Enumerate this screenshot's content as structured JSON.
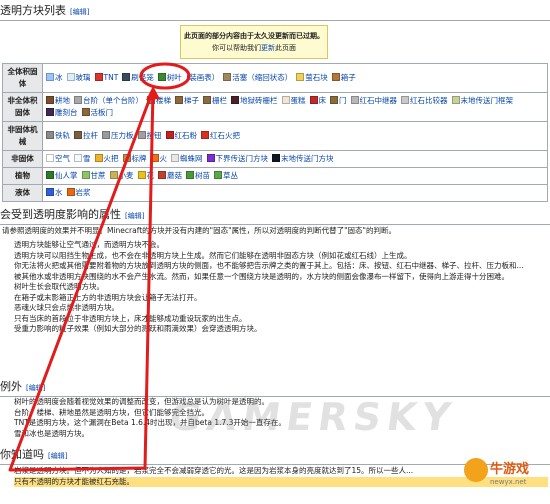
{
  "section1": {
    "title": "透明方块列表",
    "edit": "[编辑]"
  },
  "notice": {
    "line1": "此页面的部分内容由于太久没更新而已过期。",
    "line2_pre": "你可以帮助我们",
    "line2_link": "更新",
    "line2_post": "此页面"
  },
  "table": {
    "rows": [
      {
        "header": "全体积固体",
        "items": [
          {
            "label": "冰",
            "color": "#9bc3ff"
          },
          {
            "label": "玻璃",
            "color": "#d9f0f8"
          },
          {
            "label": "TNT",
            "color": "#d8352b"
          },
          {
            "label": "刷怪笼",
            "color": "#3a4a5a"
          },
          {
            "label": "树叶（装画表）",
            "color": "#3d8a2e"
          },
          {
            "label": "活塞（缩回状态）",
            "color": "#a08860"
          },
          {
            "label": "萤石块",
            "color": "#f1d05a"
          },
          {
            "label": "箱子",
            "color": "#b0783a"
          }
        ]
      },
      {
        "header": "非全体积固体",
        "items": [
          {
            "label": "耕地",
            "color": "#7a4f2a"
          },
          {
            "label": "台阶（单个台阶）",
            "color": "#a9a9a9"
          },
          {
            "label": "楼梯",
            "color": "#9c7b4e"
          },
          {
            "label": "梯子",
            "color": "#8d6a3c"
          },
          {
            "label": "栅栏",
            "color": "#8a6c42"
          },
          {
            "label": "地狱砖栅栏",
            "color": "#4a2328"
          },
          {
            "label": "蛋糕",
            "color": "#f3e5d3"
          },
          {
            "label": "床",
            "color": "#c02a2a"
          },
          {
            "label": "门",
            "color": "#8b6b3c"
          },
          {
            "label": "红石中继器",
            "color": "#b8b8b8"
          },
          {
            "label": "红石比较器",
            "color": "#c9c9c9"
          },
          {
            "label": "末地传送门框架",
            "color": "#c8d39a"
          },
          {
            "label": "雕刻台",
            "color": "#3f2a4f"
          },
          {
            "label": "活板门",
            "color": "#8b6a38"
          }
        ]
      },
      {
        "header": "非固体机械",
        "items": [
          {
            "label": "铁轨",
            "color": "#8a8a8a"
          },
          {
            "label": "拉杆",
            "color": "#7a6040"
          },
          {
            "label": "压力板",
            "color": "#9a9a9a"
          },
          {
            "label": "按钮",
            "color": "#a0a0a0"
          },
          {
            "label": "红石粉",
            "color": "#c02020"
          },
          {
            "label": "红石火把",
            "color": "#d63020"
          }
        ]
      },
      {
        "header": "非固体",
        "items": [
          {
            "label": "空气",
            "color": "#ffffff"
          },
          {
            "label": "雪",
            "color": "#f4f8ff"
          },
          {
            "label": "火把",
            "color": "#f0b030"
          },
          {
            "label": "标牌",
            "color": "#b89050"
          },
          {
            "label": "火",
            "color": "#f07020"
          },
          {
            "label": "蜘蛛网",
            "color": "#e8e8e8"
          },
          {
            "label": "下界传送门方块",
            "color": "#7a2fcf"
          },
          {
            "label": "末地传送门方块",
            "color": "#101820"
          }
        ]
      },
      {
        "header": "植物",
        "items": [
          {
            "label": "仙人掌",
            "color": "#2f7a2a"
          },
          {
            "label": "甘蔗",
            "color": "#8fc46a"
          },
          {
            "label": "小麦",
            "color": "#c9b05a"
          },
          {
            "label": "花",
            "color": "#e8c020"
          },
          {
            "label": "蘑菇",
            "color": "#c04030"
          },
          {
            "label": "树苗",
            "color": "#4a9a3a"
          },
          {
            "label": "草丛",
            "color": "#5aa84a"
          }
        ]
      },
      {
        "header": "液体",
        "items": [
          {
            "label": "水",
            "color": "#2f5fd8"
          },
          {
            "label": "岩浆",
            "color": "#e86a10"
          }
        ]
      }
    ]
  },
  "section2": {
    "title": "会受到透明度影响的属性",
    "edit": "[编辑]",
    "intro": "请参照透明度的效果并不明显。Minecraft的方块并没有内建的\"固态\"属性，所以对透明度的判断代替了\"固态\"的判断。",
    "bullets": [
      "透明方块能够让空气通过，而透明方块不会。",
      "透明方块可以阻挡生物生成，也不会在非透明方块上生成。然而它们能够在透明非固态方块（例如花或红石线）上生成。",
      "你无法将火把或其他需要附着物的方块放到透明方块的侧面，也不能够把告示牌之类的置于其上。包括：床、按钮、红石中继器、梯子、拉杆、压力板和...",
      "被其他水或非透明方块围绕的水不会产生水流。然而，如果任意一个围绕方块是透明的，水方块的侧面会像瀑布一样留下，使得向上游走得十分困难。",
      "树叶生长会取代透明方块。",
      "在箱子或末影箱正上方的非透明方块会让箱子无法打开。",
      "恶魂火球只会点燃非透明方块。",
      "只有当床的首段位于非透明方块上，床才能够成功重设玩家的出生点。",
      "受重力影响的粒子效果（例如大部分的溅跃和雨滴效果）会穿透透明方块。"
    ]
  },
  "section3": {
    "title": "例外",
    "edit": "[编辑]",
    "bullets": [
      "树叶的透明度会随着视觉效果的调整而改变，但游戏总是认为树叶是透明的。",
      "台阶、楼梯、耕地虽然是透明方块，但它们能够完全挡光。",
      "TNT是透明方块，这个漏洞在Beta 1.6.4时出现，并自beta 1.7.3开始一直存在。",
      "雪和冰也是透明方块。"
    ]
  },
  "section4": {
    "title": "你知道吗",
    "edit": "[编辑]",
    "bullets": [
      "岩浆是透明方块。但不为人知的是，岩浆完全不会减弱穿透它的光。这是因为岩浆本身的亮度就达到了15。所以一些人...",
      "只有不透明的方块才能被红石充能。"
    ]
  },
  "watermark": "GAMERSKY",
  "site_logo": {
    "name": "牛游戏",
    "url": "newyx.net"
  }
}
